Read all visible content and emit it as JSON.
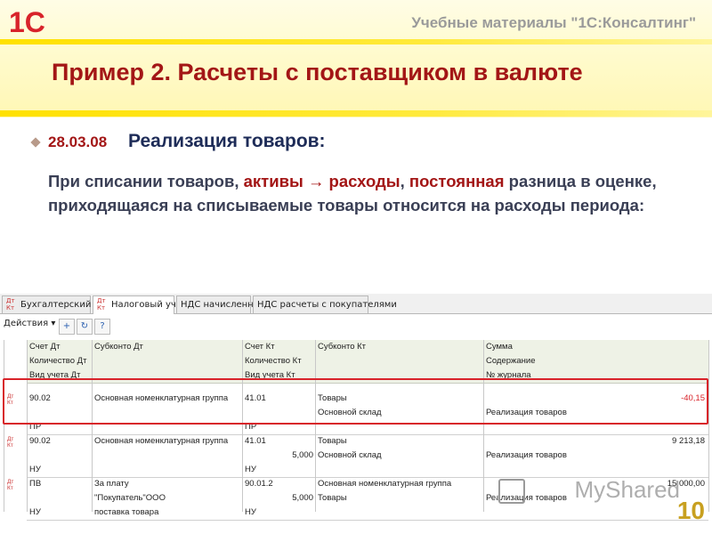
{
  "header": {
    "logo_text": "1C",
    "subtitle": "Учебные материалы \"1С:Консалтинг\"",
    "title": "Пример 2. Расчеты с поставщиком в валюте"
  },
  "content": {
    "date": "28.03.08",
    "heading": "Реализация товаров:",
    "para_part1": "При списании товаров, ",
    "para_part2": "активы → расходы",
    "para_part3": ", ",
    "para_part4": "постоянная",
    "para_part5": " разница в оценке, приходящаяся на списываемые товары относится на расходы периода:"
  },
  "tabs": [
    {
      "icon": "Дт Кт",
      "label": "Бухгалтерский учет"
    },
    {
      "icon": "Дт Кт",
      "label": "Налоговый учет"
    },
    {
      "icon": "",
      "label": "НДС начисленный"
    },
    {
      "icon": "",
      "label": "НДС расчеты с покупателями"
    }
  ],
  "toolbar": {
    "actions_label": "Действия ▾",
    "icons": [
      "add-icon",
      "refresh-icon",
      "help-icon"
    ]
  },
  "table": {
    "header_rows": [
      [
        "Счет Дт",
        "Субконто Дт",
        "Счет Кт",
        "Субконто Кт",
        "Сумма"
      ],
      [
        "Количество Дт",
        "",
        "Количество Кт",
        "",
        "Содержание"
      ],
      [
        "Вид учета Дт",
        "",
        "Вид учета Кт",
        "",
        "№ журнала"
      ]
    ],
    "rows": [
      {
        "lines": [
          [
            "90.02",
            "Основная номенклатурная группа",
            "41.01",
            "Товары",
            "-40,15"
          ],
          [
            "",
            "",
            "",
            "Основной склад",
            "Реализация товаров"
          ],
          [
            "ПР",
            "",
            "ПР",
            "",
            ""
          ]
        ]
      },
      {
        "lines": [
          [
            "90.02",
            "Основная номенклатурная группа",
            "41.01",
            "Товары",
            "9 213,18"
          ],
          [
            "",
            "",
            "5,000",
            "Основной склад",
            "Реализация товаров"
          ],
          [
            "НУ",
            "",
            "НУ",
            "",
            ""
          ]
        ]
      },
      {
        "lines": [
          [
            "ПВ",
            "За плату",
            "90.01.2",
            "Основная номенклатурная группа",
            "15 000,00"
          ],
          [
            "",
            "\"Покупатель\"ООО",
            "5,000",
            "Товары",
            "Реализация товаров"
          ],
          [
            "НУ",
            "поставка товара",
            "НУ",
            "",
            ""
          ]
        ]
      }
    ]
  },
  "watermark": "MyShared",
  "page_number": "10",
  "colors": {
    "accent_red": "#a31616",
    "highlight": "#d8232a",
    "yellow": "#ffe100"
  }
}
